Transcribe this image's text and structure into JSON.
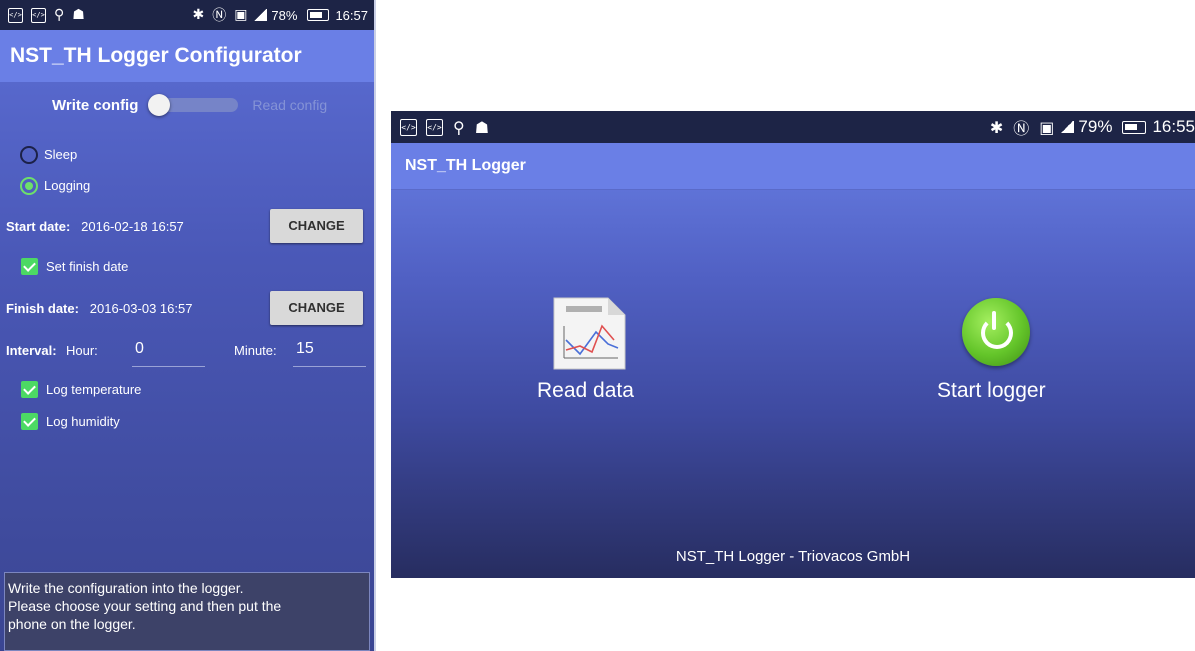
{
  "phone_left": {
    "status_bar": {
      "battery": "78%",
      "time": "16:57"
    },
    "app_title": "NST_TH Logger Configurator",
    "toggle": {
      "left_label": "Write config",
      "right_label": "Read config",
      "state": "write"
    },
    "modes": [
      {
        "label": "Sleep",
        "selected": false
      },
      {
        "label": "Logging",
        "selected": true
      }
    ],
    "start_date": {
      "label": "Start date:",
      "value": "2016-02-18 16:57",
      "button": "CHANGE"
    },
    "set_finish": {
      "label": "Set finish date",
      "checked": true
    },
    "finish_date": {
      "label": "Finish date:",
      "value": "2016-03-03 16:57",
      "button": "CHANGE"
    },
    "interval": {
      "label": "Interval:",
      "hour_label": "Hour:",
      "hour_value": "0",
      "minute_label": "Minute:",
      "minute_value": "15"
    },
    "log_options": [
      {
        "label": "Log temperature",
        "checked": true
      },
      {
        "label": "Log humidity",
        "checked": true
      }
    ],
    "message": [
      "Write the configuration into the logger.",
      "Please choose your setting and then put the",
      "phone on the logger."
    ]
  },
  "phone_right": {
    "status_bar": {
      "battery": "79%",
      "time": "16:55"
    },
    "app_title": "NST_TH Logger",
    "read_label": "Read data",
    "start_label": "Start logger",
    "footer": "NST_TH Logger - Triovacos GmbH"
  },
  "colors": {
    "appbar": "#6a7fe6",
    "statusbar": "#1d2446",
    "accent_green": "#4cd964"
  }
}
